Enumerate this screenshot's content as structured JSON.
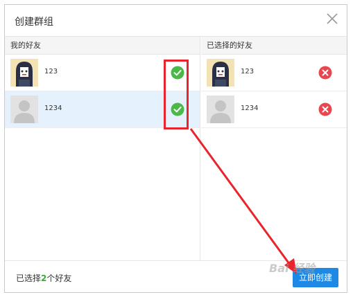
{
  "dialog": {
    "title": "创建群组",
    "close_icon": "close-icon"
  },
  "left_panel": {
    "header": "我的好友",
    "friends": [
      {
        "name": "123",
        "avatar": "cartoon-avatar",
        "checked": true,
        "selected_row": false
      },
      {
        "name": "1234",
        "avatar": "default-avatar",
        "checked": true,
        "selected_row": true
      }
    ]
  },
  "right_panel": {
    "header": "已选择的好友",
    "selected": [
      {
        "name": "123",
        "avatar": "cartoon-avatar"
      },
      {
        "name": "1234",
        "avatar": "default-avatar"
      }
    ]
  },
  "footer": {
    "prefix": "已选择",
    "count": "2",
    "suffix": "个好友",
    "create_button": "立即创建"
  },
  "watermark": "Bai 经验",
  "colors": {
    "check_green": "#4cb848",
    "remove_red": "#e8474f",
    "button_blue": "#1e88e5",
    "annotation_red": "#e8242c",
    "selected_row": "#e5f1fd"
  }
}
